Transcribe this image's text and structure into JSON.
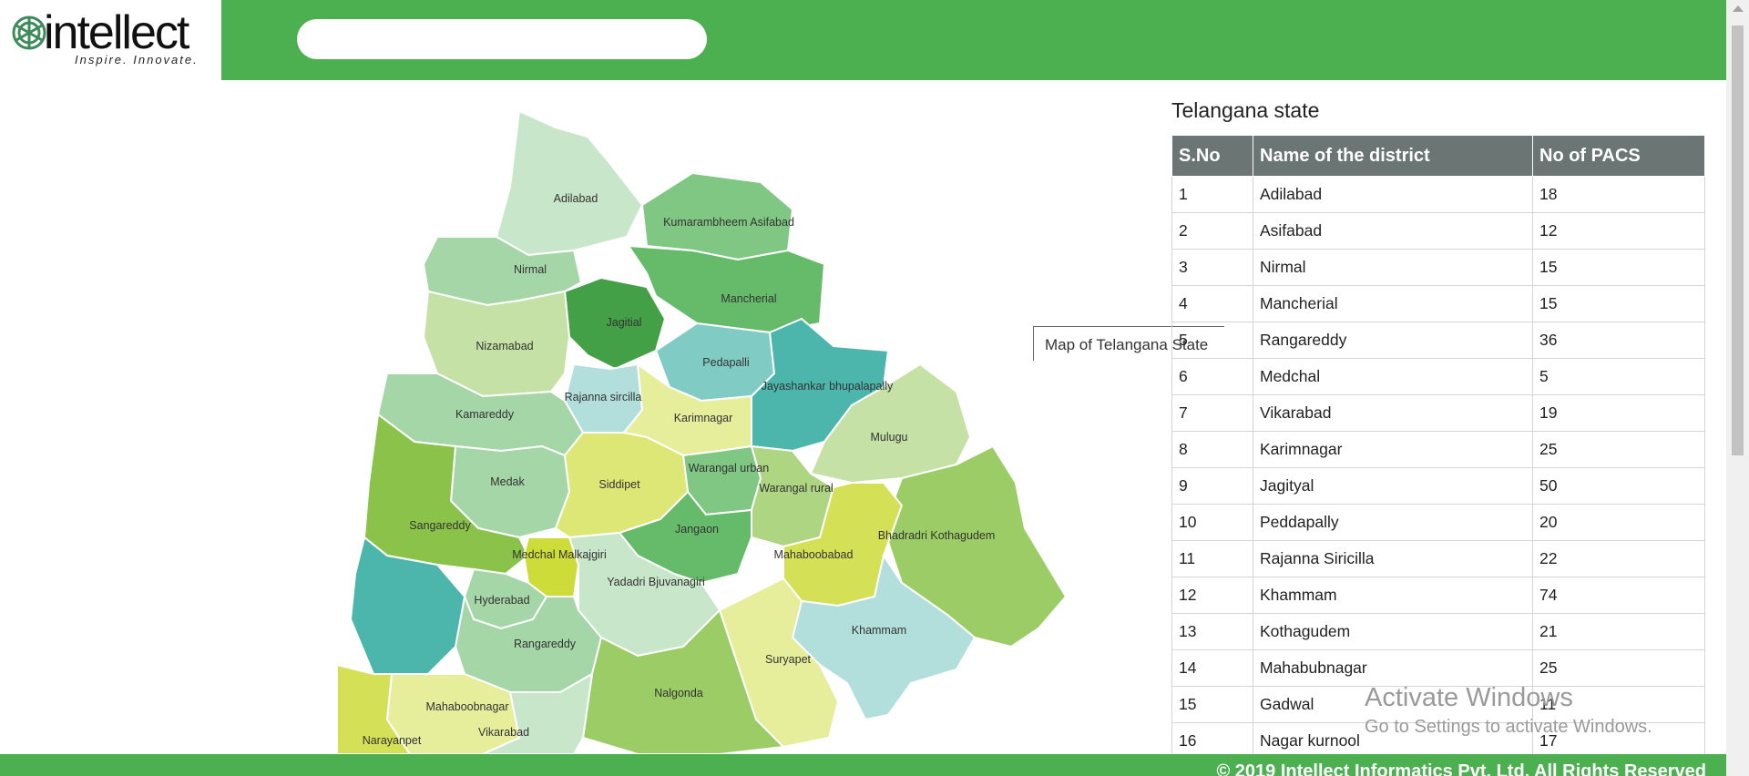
{
  "header": {
    "logo_text": "intellect",
    "logo_tagline": "Inspire. Innovate.",
    "search_value": "",
    "accent": "#4caf50"
  },
  "map": {
    "tooltip": "Map of Telangana State",
    "labels": [
      "Adilabad",
      "Kumarambheem Asifabad",
      "Nirmal",
      "Mancherial",
      "Jagitial",
      "Nizamabad",
      "Pedapalli",
      "Jayashankar bhupalapally",
      "Rajanna sircilla",
      "Karimnagar",
      "Kamareddy",
      "Mulugu",
      "Warangal urban",
      "Warangal rural",
      "Medak",
      "Siddipet",
      "Sangareddy",
      "Jangaon",
      "Bhadradri Kothagudem",
      "Mahaboobabad",
      "Medchal Malkajgiri",
      "Yadadri Bjuvanagiri",
      "Hyderabad",
      "Rangareddy",
      "Khammam",
      "Suryapet",
      "Nalgonda",
      "Mahaboobnagar",
      "Vikarabad",
      "Narayanpet"
    ]
  },
  "table": {
    "title": "Telangana state",
    "headers": [
      "S.No",
      "Name of the district",
      "No of PACS"
    ],
    "rows": [
      [
        "1",
        "Adilabad",
        "18"
      ],
      [
        "2",
        "Asifabad",
        "12"
      ],
      [
        "3",
        "Nirmal",
        "15"
      ],
      [
        "4",
        "Mancherial",
        "15"
      ],
      [
        "5",
        "Rangareddy",
        "36"
      ],
      [
        "6",
        "Medchal",
        "5"
      ],
      [
        "7",
        "Vikarabad",
        "19"
      ],
      [
        "8",
        "Karimnagar",
        "25"
      ],
      [
        "9",
        "Jagityal",
        "50"
      ],
      [
        "10",
        "Peddapally",
        "20"
      ],
      [
        "11",
        "Rajanna Siricilla",
        "22"
      ],
      [
        "12",
        "Khammam",
        "74"
      ],
      [
        "13",
        "Kothagudem",
        "21"
      ],
      [
        "14",
        "Mahabubnagar",
        "25"
      ],
      [
        "15",
        "Gadwal",
        "11"
      ],
      [
        "16",
        "Nagar kurnool",
        "17"
      ]
    ]
  },
  "watermark": {
    "line1": "Activate Windows",
    "line2": "Go to Settings to activate Windows."
  },
  "footer": {
    "copyright": "© 2019 Intellect Informatics Pvt. Ltd. All Rights Reserved"
  }
}
